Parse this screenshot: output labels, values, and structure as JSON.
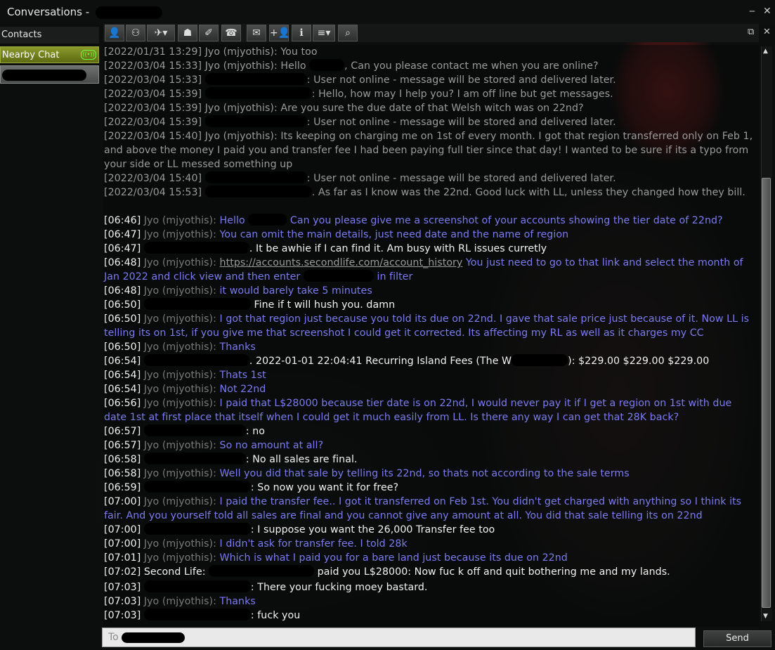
{
  "window": {
    "title": "Conversations -",
    "minimize_icon": "minimize-icon",
    "close_icon": "close-icon"
  },
  "sidebar": {
    "contacts_label": "Contacts",
    "nearby_label": "Nearby Chat"
  },
  "toolbar": {
    "icons": [
      "profile-icon",
      "friends-icon",
      "teleport-icon",
      "gift-icon",
      "pay-icon",
      "call-icon",
      "im-icon",
      "add-friend-icon",
      "info-icon",
      "menu-icon",
      "search-icon"
    ],
    "float_icon": "float-window-icon",
    "close_icon": "close-panel-icon"
  },
  "chat": {
    "lines": [
      {
        "t": "[2022/01/31 13:29] Jyo (mjyothis): You too"
      },
      {
        "t": "[2022/03/04 15:33] Jyo (mjyothis): Hello",
        "r": 50,
        "t2": ", Can you please contact me when you are online?"
      },
      {
        "t": "[2022/03/04 15:33]",
        "r": 145,
        "t2": ": User not online - message will be stored and delivered later."
      },
      {
        "t": "[2022/03/04 15:39]",
        "r": 152,
        "t2": ": Hello, how may I help you? I am off line but get messages."
      },
      {
        "t": "[2022/03/04 15:39] Jyo (mjyothis): Are you sure the due date of that Welsh witch was on 22nd?"
      },
      {
        "t": "[2022/03/04 15:39]",
        "r": 145,
        "t2": ": User not online - message will be stored and delivered later."
      },
      {
        "t": "[2022/03/04 15:40] Jyo (mjyothis): Its keeping on charging me on 1st of every month. I got that region transferred only on Feb 1, and above the money I paid you and transfer fee I had been paying full tier since that day! I wanted to be sure if its a typo from your side or LL messed something up"
      },
      {
        "t": "[2022/03/04 15:40]",
        "r": 145,
        "t2": ": User not online - message will be stored and delivered later."
      },
      {
        "t": "[2022/03/04 15:53]",
        "r": 152,
        "t2": ". As far as I know was the 22nd.  Good luck with LL, unless they changed how they bill."
      },
      {
        "time": "[06:46]",
        "name": "Jyo (mjyothis):",
        "msg": "Hello",
        "r": 55,
        "msg2": " Can you please give me a screenshot of your accounts showing the tier date of 22nd?"
      },
      {
        "time": "[06:47]",
        "name": "Jyo (mjyothis):",
        "msg": "You can omit the main details, just need date and the name of region"
      },
      {
        "time": "[06:47]",
        "r": 150,
        "msg": ". It be awhie if I can find it. Am busy with RL issues curretly"
      },
      {
        "time": "[06:48]",
        "name": "Jyo (mjyothis):",
        "link": "https://accounts.secondlife.com/account_history",
        "msg": "You just need to go to that link and select the month of Jan 2022 and click view and then enter",
        "r": 100,
        "msg2": "in filter"
      },
      {
        "time": "[06:48]",
        "name": "Jyo (mjyothis):",
        "msg": "it would barely take 5 minutes"
      },
      {
        "time": "[06:50]",
        "r": 152,
        "msg": "Fine if t will hush you. damn"
      },
      {
        "time": "[06:50]",
        "name": "Jyo (mjyothis):",
        "msg": "I got that region just because you told its due on 22nd. I gave that sale price just because of it. Now LL is telling its on 1st, if you give me that screenshot I could get it corrected. Its affecting my RL as well as it charges my CC"
      },
      {
        "time": "[06:50]",
        "name": "Jyo (mjyothis):",
        "msg": "Thanks"
      },
      {
        "time": "[06:54]",
        "r": 150,
        "msg": ". 2022-01-01 22:04:41    Recurring Island Fees (The W",
        "r2": 80,
        "msg2": "): $229.00    $229.00    $229.00"
      },
      {
        "time": "[06:54]",
        "name": "Jyo (mjyothis):",
        "msg": "Thats 1st"
      },
      {
        "time": "[06:54]",
        "name": "Jyo (mjyothis):",
        "msg": "Not 22nd"
      },
      {
        "time": "[06:56]",
        "name": "Jyo (mjyothis):",
        "msg": "I paid that L$28000 because tier date is on 22nd, I would never pay it if I get a region on 1st with due date 1st at first place that itself when I could get it much easily from LL. Is there any way I can get that 28K back?"
      },
      {
        "time": "[06:57]",
        "r": 145,
        "msg": ": no"
      },
      {
        "time": "[06:57]",
        "name": "Jyo (mjyothis):",
        "msg": "So no amount at all?"
      },
      {
        "time": "[06:58]",
        "r": 145,
        "msg": ": No all sales are final."
      },
      {
        "time": "[06:58]",
        "name": "Jyo (mjyothis):",
        "msg": "Well you did that sale by telling its 22nd, so thats not according to the sale terms"
      },
      {
        "time": "[06:59]",
        "r": 152,
        "msg": ": So now you want it for free?"
      },
      {
        "time": "[07:00]",
        "name": "Jyo (mjyothis):",
        "msg": "I paid the transfer fee.. I got it transferred on Feb 1st. You didn't get charged with anything so I think its fair. And you yourself told all sales are final and you cannot give any amount at all. You did that sale telling its on 22nd"
      },
      {
        "time": "[07:00]",
        "r": 152,
        "msg": ": I suppose you want  the 26,000 Transfer fee too"
      },
      {
        "time": "[07:00]",
        "name": "Jyo (mjyothis):",
        "msg": "I didn't ask for transfer fee. I told 28k"
      },
      {
        "time": "[07:01]",
        "name": "Jyo (mjyothis):",
        "msg": "Which is what I paid you for a bare land just because its due on 22nd"
      },
      {
        "time": "[07:02]",
        "prefix": "Second Life:",
        "r": 150,
        "msg": " paid you L$28000: Now fuc k off and quit bothering me and my lands."
      },
      {
        "time": "[07:03]",
        "r": 152,
        "msg": ": There your fucking moey bastard."
      },
      {
        "time": "[07:03]",
        "name": "Jyo (mjyothis):",
        "msg": "Thanks"
      },
      {
        "time": "[07:03]",
        "r": 152,
        "msg": ": fuck you"
      }
    ]
  },
  "input": {
    "placeholder": "To",
    "send_label": "Send"
  }
}
